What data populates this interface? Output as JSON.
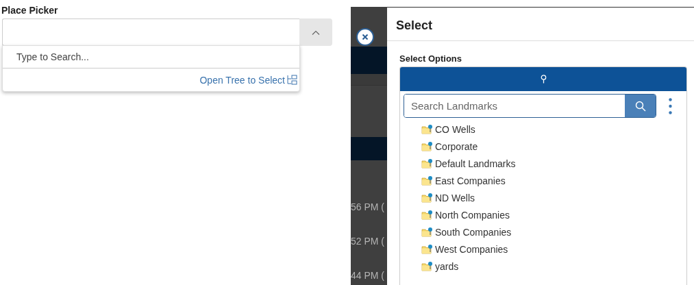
{
  "place_picker": {
    "label": "Place Picker",
    "expanded": true,
    "search": {
      "placeholder": "Type to Search..."
    },
    "tree_link": "Open Tree to Select"
  },
  "background": {
    "times": [
      "56 PM (",
      "52 PM (",
      "44 PM ("
    ]
  },
  "dialog": {
    "title": "Select",
    "section_label": "Select Options",
    "search": {
      "placeholder": "Search Landmarks"
    },
    "items": [
      {
        "label": "CO Wells"
      },
      {
        "label": "Corporate"
      },
      {
        "label": "Default Landmarks"
      },
      {
        "label": "East Companies"
      },
      {
        "label": "ND Wells"
      },
      {
        "label": "North Companies"
      },
      {
        "label": "South Companies"
      },
      {
        "label": "West Companies"
      },
      {
        "label": "yards"
      }
    ]
  }
}
